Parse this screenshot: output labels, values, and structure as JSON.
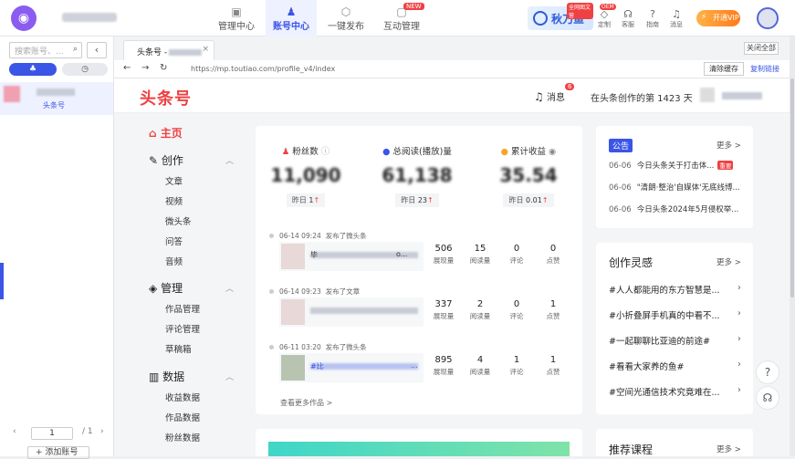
{
  "header": {
    "nav": [
      {
        "label": "管理中心",
        "icon": "dashboard-icon"
      },
      {
        "label": "账号中心",
        "icon": "account-icon",
        "active": true
      },
      {
        "label": "一键发布",
        "icon": "publish-icon"
      },
      {
        "label": "互动管理",
        "icon": "chat-icon"
      }
    ],
    "new_badge": "NEW",
    "qiuyu": {
      "label": "秋刀鱼",
      "tag": "全网图文营"
    },
    "tools": [
      {
        "label": "定制",
        "icon": "diamond-icon",
        "badge": "OEM"
      },
      {
        "label": "客服",
        "icon": "headset-icon"
      },
      {
        "label": "指南",
        "icon": "help-icon"
      },
      {
        "label": "消息",
        "icon": "bell-icon"
      }
    ],
    "vip": "开通VIP"
  },
  "left": {
    "search_placeholder": "搜索账号、...",
    "platform": "头条号",
    "page_current": "1",
    "page_total": "/ 1",
    "add_account": "+ 添加账号"
  },
  "tabs": {
    "tab_label": "头条号 -",
    "close_all": "关闭全部"
  },
  "urlbar": {
    "url": "https://mp.toutiao.com/profile_v4/index",
    "clear_cache": "清除缓存",
    "copy_link": "复制链接"
  },
  "toutiao": {
    "logo": "头条号",
    "message_label": "消息",
    "message_count": "6",
    "days_text": "在头条创作的第 1423 天"
  },
  "menu": {
    "home": "主页",
    "sections": [
      {
        "title": "创作",
        "icon": "pen-icon",
        "items": [
          "文章",
          "视频",
          "微头条",
          "问答",
          "音频"
        ]
      },
      {
        "title": "管理",
        "icon": "layers-icon",
        "items": [
          "作品管理",
          "评论管理",
          "草稿箱"
        ]
      },
      {
        "title": "数据",
        "icon": "chart-icon",
        "items": [
          "收益数据",
          "作品数据",
          "粉丝数据"
        ]
      }
    ]
  },
  "stats": [
    {
      "label": "粉丝数",
      "value": "11,090",
      "yday_label": "昨日",
      "yday": "1"
    },
    {
      "label": "总阅读(播放)量",
      "value": "61,138",
      "yday_label": "昨日",
      "yday": "23"
    },
    {
      "label": "累计收益",
      "value": "35.54",
      "yday_label": "昨日",
      "yday": "0.01"
    }
  ],
  "feed": [
    {
      "time": "06-14 09:24",
      "action": "发布了微头条",
      "title": "毕",
      "title_tail": "o...",
      "views": "506",
      "reads": "15",
      "comments": "0",
      "likes": "0"
    },
    {
      "time": "06-14 09:23",
      "action": "发布了文章",
      "title": "",
      "title_tail": "",
      "views": "337",
      "reads": "2",
      "comments": "0",
      "likes": "1"
    },
    {
      "time": "06-11 03:20",
      "action": "发布了微头条",
      "title": "#比",
      "title_tail": "...",
      "views": "895",
      "reads": "4",
      "comments": "1",
      "likes": "1"
    }
  ],
  "metric_labels": {
    "views": "展现量",
    "reads": "阅读量",
    "comments": "评论",
    "likes": "点赞"
  },
  "more_works": "查看更多作品 >",
  "notices": {
    "title": "公告",
    "more": "更多 >",
    "items": [
      {
        "date": "06-06",
        "text": "今日头条关于打击体...",
        "tag": "重要"
      },
      {
        "date": "06-06",
        "text": "\"清朗·整治'自媒体'无底线博...",
        "tag": ""
      },
      {
        "date": "06-06",
        "text": "今日头条2024年5月侵权举...",
        "tag": ""
      }
    ]
  },
  "inspiration": {
    "title": "创作灵感",
    "more": "更多 >",
    "items": [
      "#人人都能用的东方智慧是...",
      "#小折叠屏手机真的中看不...",
      "#一起聊聊比亚迪的前途#",
      "#看看大家养的鱼#",
      "#空间光通信技术究竟难在..."
    ]
  },
  "courses": {
    "title": "推荐课程",
    "more": "更多 >"
  }
}
